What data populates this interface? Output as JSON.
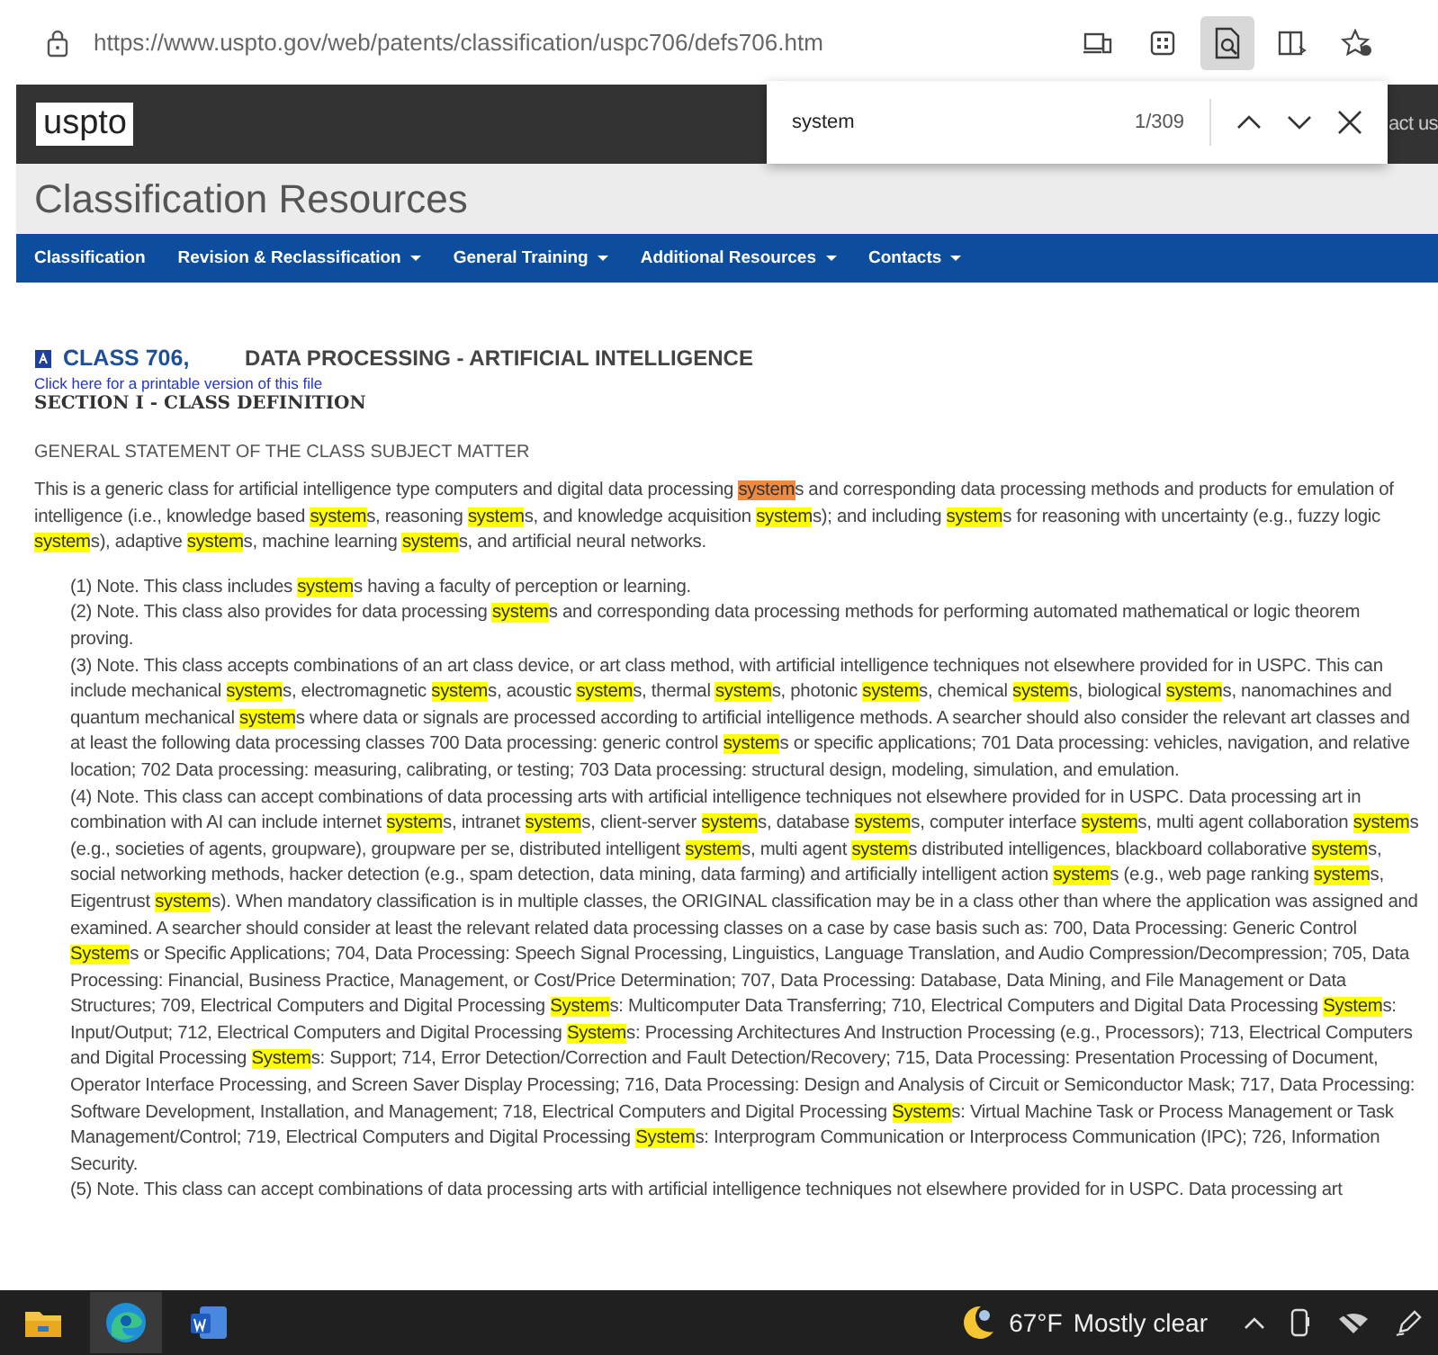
{
  "browser": {
    "url": "https://www.uspto.gov/web/patents/classification/uspc706/defs706.htm",
    "toolbar": [
      {
        "kind": "device",
        "selected": false
      },
      {
        "kind": "grid",
        "selected": false
      },
      {
        "kind": "find",
        "selected": true
      },
      {
        "kind": "reader",
        "selected": false
      },
      {
        "kind": "favorite",
        "selected": false
      }
    ]
  },
  "find_bar": {
    "value": "system",
    "count": "1/309"
  },
  "site": {
    "logo": "uspto",
    "partial_link": "act us",
    "title": "Classification Resources",
    "nav": [
      {
        "label": "Classification",
        "dropdown": false
      },
      {
        "label": "Revision & Reclassification",
        "dropdown": true
      },
      {
        "label": "General Training",
        "dropdown": true
      },
      {
        "label": "Additional Resources",
        "dropdown": true
      },
      {
        "label": "Contacts",
        "dropdown": true
      }
    ]
  },
  "content": {
    "class_number": "CLASS 706,",
    "class_title": "DATA PROCESSING - ARTIFICIAL INTELLIGENCE",
    "print_link": "Click here for a printable version of this file",
    "section": "SECTION I - CLASS DEFINITION",
    "subheading": "GENERAL STATEMENT OF THE CLASS SUBJECT MATTER",
    "intro": [
      {
        "text": "This is a generic class for artificial intelligence type computers and digital data processing ",
        "current": false
      },
      {
        "text": "system",
        "current": true
      },
      {
        "text": "s and corresponding data processing methods and products for emulation of intelligence (i.e., knowledge based **system**s, reasoning **system**s, and knowledge acquisition **system**s); and including **system**s for reasoning with uncertainty (e.g., fuzzy logic **system**s), adaptive **system**s, machine learning **system**s, and artificial neural networks.",
        "current": false
      }
    ],
    "notes": [
      "(1) Note. This class includes **system**s having a faculty of perception or learning.",
      "(2) Note. This class also provides for data processing **system**s and corresponding data processing methods for performing automated mathematical or logic theorem proving.",
      "(3) Note. This class accepts combinations of an art class device, or art class method, with artificial intelligence techniques not elsewhere provided for in USPC. This can include mechanical **system**s, electromagnetic **system**s, acoustic **system**s, thermal **system**s, photonic **system**s, chemical **system**s, biological **system**s, nanomachines and quantum mechanical **system**s where data or signals are processed according to artificial intelligence methods. A searcher should also consider the relevant art classes and at least the following data processing classes 700 Data processing: generic control **system**s or specific applications; 701 Data processing: vehicles, navigation, and relative location; 702 Data processing: measuring, calibrating, or testing; 703 Data processing: structural design, modeling, simulation, and emulation.",
      "(4) Note. This class can accept combinations of data processing arts with artificial intelligence techniques not elsewhere provided for in USPC. Data processing art in combination with AI can include internet **system**s, intranet **system**s, client-server **system**s, database **system**s, computer interface **system**s, multi agent collaboration **system**s (e.g., societies of agents, groupware), groupware per se, distributed intelligent **system**s, multi agent **system**s distributed intelligences, blackboard collaborative **system**s, social networking methods, hacker detection (e.g., spam detection, data mining, data farming) and artificially intelligent action **system**s (e.g., web page ranking **system**s, Eigentrust **system**s). When mandatory classification is in multiple classes, the ORIGINAL classification may be in a class other than where the application was assigned and examined. A searcher should consider at least the relevant related data processing classes on a case by case basis such as: 700, Data Processing: Generic Control **System**s or Specific Applications; 704, Data Processing: Speech Signal Processing, Linguistics, Language Translation, and Audio Compression/Decompression; 705, Data Processing: Financial, Business Practice, Management, or Cost/Price Determination; 707, Data Processing: Database, Data Mining, and File Management or Data Structures; 709, Electrical Computers and Digital Processing **System**s: Multicomputer Data Transferring; 710, Electrical Computers and Digital Data Processing **System**s: Input/Output; 712, Electrical Computers and Digital Processing **System**s: Processing Architectures And Instruction Processing (e.g., Processors); 713, Electrical Computers and Digital Processing **System**s: Support; 714, Error Detection/Correction and Fault Detection/Recovery; 715, Data Processing: Presentation Processing of Document, Operator Interface Processing, and Screen Saver Display Processing; 716, Data Processing: Design and Analysis of Circuit or Semiconductor Mask; 717, Data Processing: Software Development, Installation, and Management; 718, Electrical Computers and Digital Processing **System**s: Virtual Machine Task or Process Management or Task Management/Control; 719, Electrical Computers and Digital Processing **System**s: Interprogram Communication or Interprocess Communication (IPC); 726, Information Security.",
      "(5) Note. This class can accept combinations of data processing arts with artificial intelligence techniques not elsewhere provided for in USPC. Data processing art"
    ]
  },
  "taskbar": {
    "apps": [
      {
        "kind": "folder",
        "selected": false
      },
      {
        "kind": "edge",
        "selected": true
      },
      {
        "kind": "word",
        "selected": false
      }
    ],
    "weather": {
      "temp": "67°F",
      "condition": "Mostly clear"
    },
    "tray": [
      {
        "kind": "chevron"
      },
      {
        "kind": "phone"
      },
      {
        "kind": "network"
      },
      {
        "kind": "pen"
      }
    ]
  }
}
